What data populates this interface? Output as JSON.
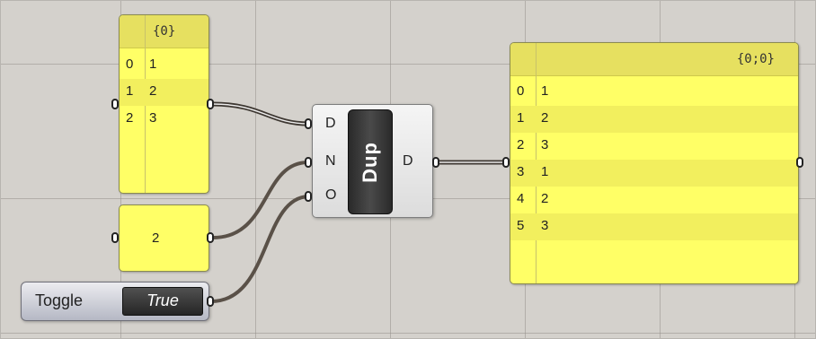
{
  "list_panel": {
    "path": "{0}",
    "rows": [
      {
        "index": "0",
        "value": "1"
      },
      {
        "index": "1",
        "value": "2"
      },
      {
        "index": "2",
        "value": "3"
      }
    ]
  },
  "number_panel": {
    "value": "2"
  },
  "toggle": {
    "label": "Toggle",
    "value": "True"
  },
  "dup_component": {
    "name": "Dup",
    "inputs": [
      "D",
      "N",
      "O"
    ],
    "output": "D"
  },
  "result_panel": {
    "path": "{0;0}",
    "rows": [
      {
        "index": "0",
        "value": "1"
      },
      {
        "index": "1",
        "value": "2"
      },
      {
        "index": "2",
        "value": "3"
      },
      {
        "index": "3",
        "value": "1"
      },
      {
        "index": "4",
        "value": "2"
      },
      {
        "index": "5",
        "value": "3"
      }
    ]
  },
  "colors": {
    "canvas": "#d4d1cc",
    "panel": "#ffff66",
    "panel_header": "#e6e060",
    "wire": "#5a5148"
  }
}
